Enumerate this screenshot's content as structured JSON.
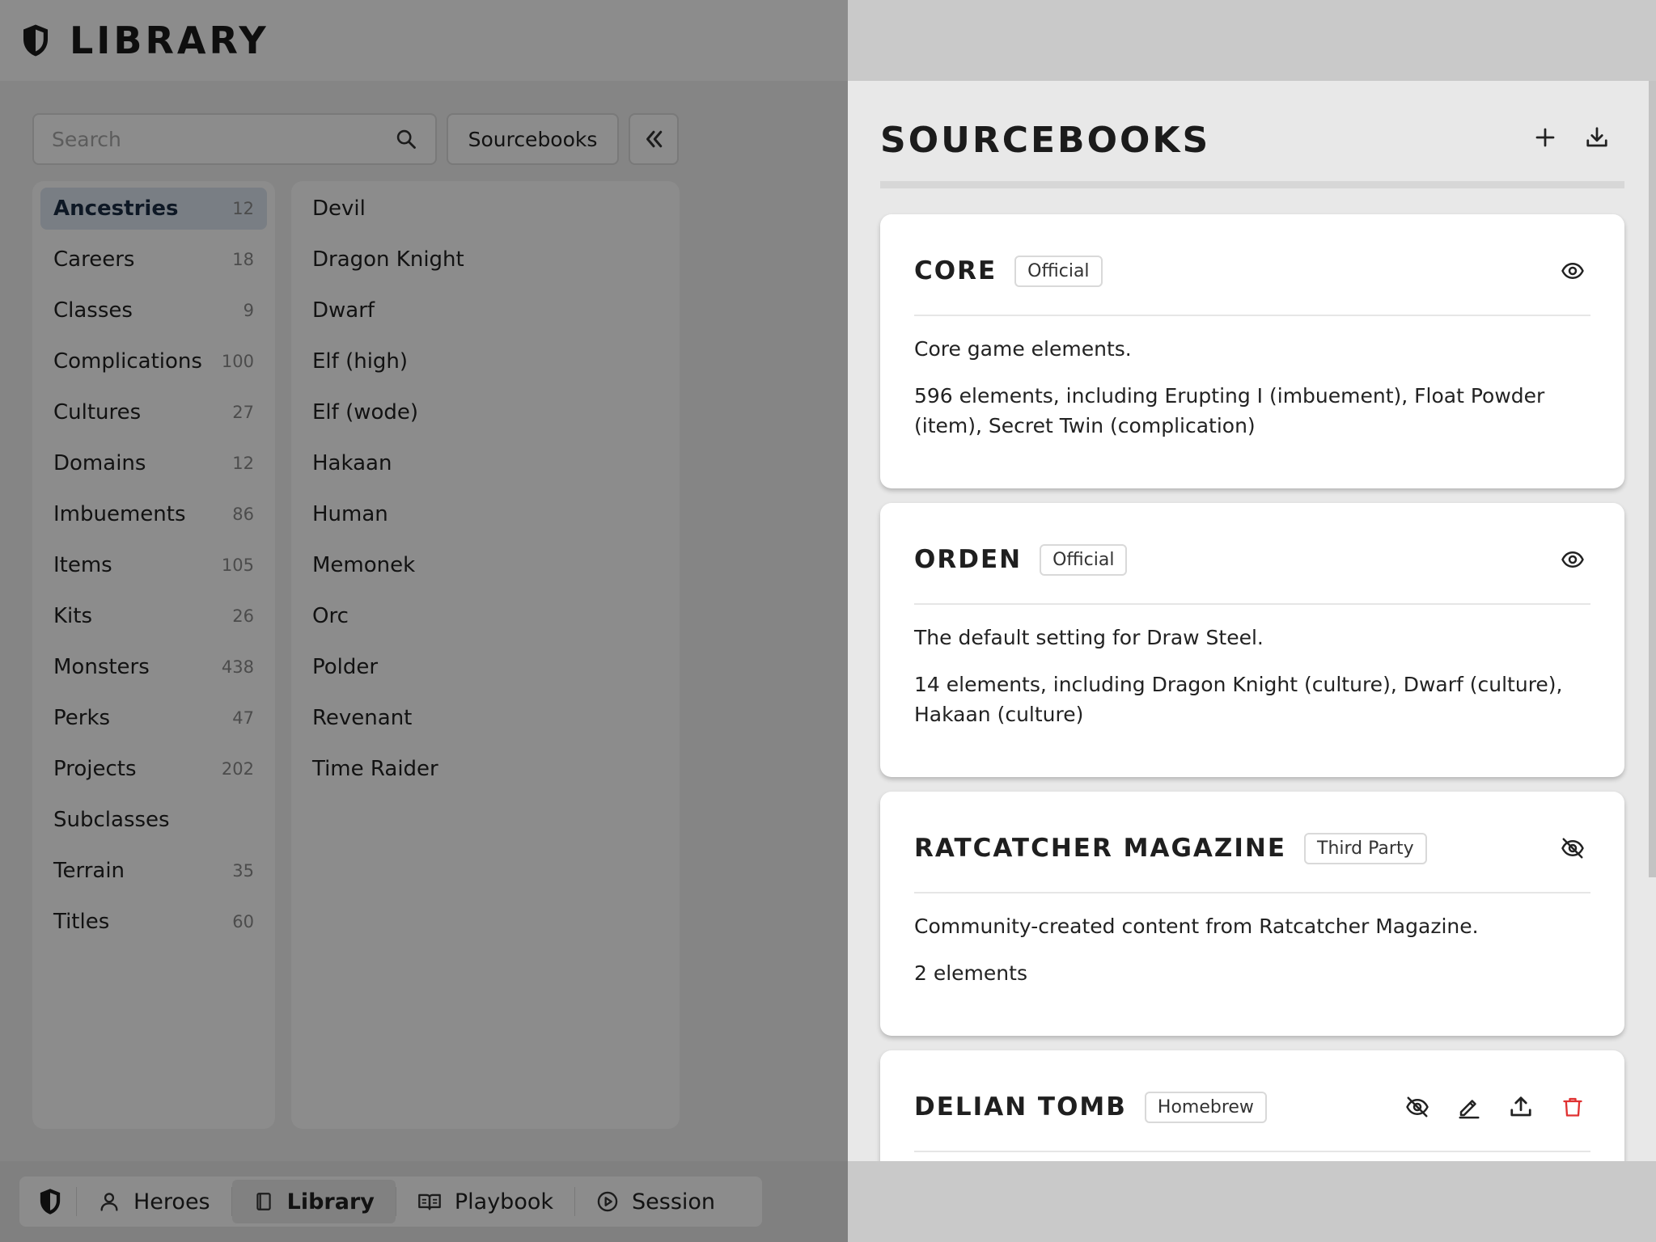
{
  "app": {
    "title": "LIBRARY"
  },
  "search": {
    "placeholder": "Search"
  },
  "toolbar": {
    "sourcebooks_label": "Sourcebooks"
  },
  "categories": [
    {
      "label": "Ancestries",
      "count": "12",
      "selected": true
    },
    {
      "label": "Careers",
      "count": "18"
    },
    {
      "label": "Classes",
      "count": "9"
    },
    {
      "label": "Complications",
      "count": "100"
    },
    {
      "label": "Cultures",
      "count": "27"
    },
    {
      "label": "Domains",
      "count": "12"
    },
    {
      "label": "Imbuements",
      "count": "86"
    },
    {
      "label": "Items",
      "count": "105"
    },
    {
      "label": "Kits",
      "count": "26"
    },
    {
      "label": "Monsters",
      "count": "438"
    },
    {
      "label": "Perks",
      "count": "47"
    },
    {
      "label": "Projects",
      "count": "202"
    },
    {
      "label": "Subclasses",
      "count": ""
    },
    {
      "label": "Terrain",
      "count": "35"
    },
    {
      "label": "Titles",
      "count": "60"
    }
  ],
  "elements": [
    "Devil",
    "Dragon Knight",
    "Dwarf",
    "Elf (high)",
    "Elf (wode)",
    "Hakaan",
    "Human",
    "Memonek",
    "Orc",
    "Polder",
    "Revenant",
    "Time Raider"
  ],
  "bottom_nav": {
    "heroes": "Heroes",
    "library": "Library",
    "playbook": "Playbook",
    "session": "Session"
  },
  "drawer": {
    "title": "SOURCEBOOKS",
    "sourcebooks": [
      {
        "name": "CORE",
        "tag": "Official",
        "description": "Core game elements.",
        "summary": "596 elements, including Erupting I (imbuement), Float Powder (item), Secret Twin (complication)",
        "visible": true
      },
      {
        "name": "ORDEN",
        "tag": "Official",
        "description": "The default setting for Draw Steel.",
        "summary": "14 elements, including Dragon Knight (culture), Dwarf (culture), Hakaan (culture)",
        "visible": true
      },
      {
        "name": "RATCATCHER MAGAZINE",
        "tag": "Third Party",
        "description": "Community-created content from Ratcatcher Magazine.",
        "summary": "2 elements",
        "visible": false
      },
      {
        "name": "DELIAN TOMB",
        "tag": "Homebrew",
        "visible": false
      }
    ]
  },
  "colors": {
    "selected_category_bg": "#dde6f0",
    "delete_icon": "#e03131",
    "overlay": "rgba(0,0,0,0.45)"
  },
  "icons": [
    "shield-logo-icon",
    "search-icon",
    "double-chevron-left-icon",
    "plus-icon",
    "download-icon",
    "eye-icon",
    "eye-off-icon",
    "pencil-icon",
    "upload-icon",
    "trash-icon",
    "user-icon",
    "book-icon",
    "open-book-icon",
    "play-circle-icon"
  ]
}
